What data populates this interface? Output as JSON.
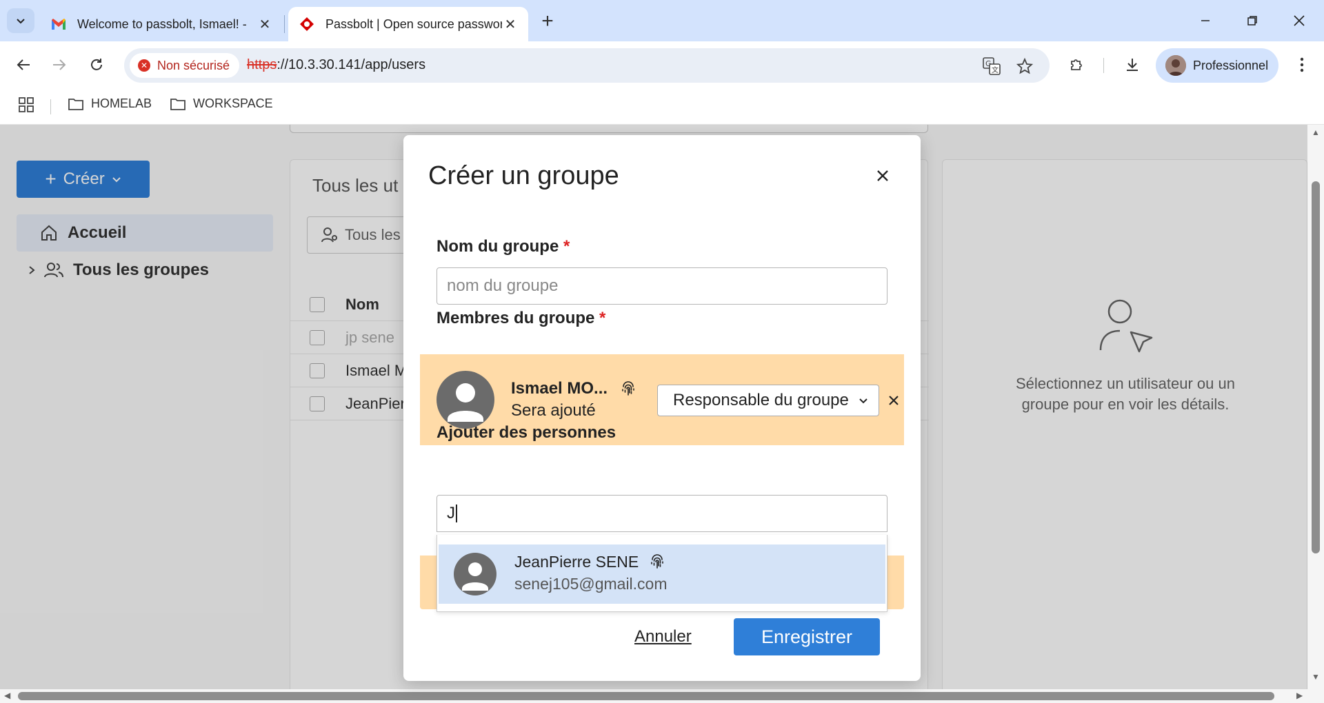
{
  "browser": {
    "tabs": [
      {
        "title": "Welcome to passbolt, Ismael! -",
        "icon": "gmail-icon",
        "active": false
      },
      {
        "title": "Passbolt | Open source passwor",
        "icon": "passbolt-icon",
        "active": true
      }
    ],
    "address": {
      "security_label": "Non sécurisé",
      "protocol": "https",
      "url_rest": "://10.3.30.141/app/users"
    },
    "profile_label": "Professionnel",
    "bookmarks": [
      "HOMELAB",
      "WORKSPACE"
    ]
  },
  "sidebar": {
    "create_label": "Créer",
    "items": [
      {
        "label": "Accueil",
        "icon": "home-icon"
      },
      {
        "label": "Tous les groupes",
        "icon": "users-icon"
      }
    ]
  },
  "main": {
    "title": "Tous les ut",
    "filter_label": "Tous les",
    "column_name": "Nom",
    "rows": [
      "jp sene",
      "Ismael M",
      "JeanPier"
    ]
  },
  "details": {
    "empty_text": "Sélectionnez un utilisateur ou un groupe pour en voir les détails."
  },
  "dialog": {
    "title": "Créer un groupe",
    "name_label": "Nom du groupe",
    "name_placeholder": "nom du groupe",
    "members_label": "Membres du groupe",
    "required_mark": "*",
    "member": {
      "name": "Ismael MO...",
      "status": "Sera ajouté",
      "role": "Responsable du groupe"
    },
    "add_label": "Ajouter des personnes",
    "search_value": "J",
    "suggestion": {
      "name": "JeanPierre SENE",
      "email": "senej105@gmail.com"
    },
    "cancel_label": "Annuler",
    "save_label": "Enregistrer"
  },
  "colors": {
    "primary": "#2f7fd8",
    "member_highlight": "#ffdba8",
    "suggestion_highlight": "#d4e3f7",
    "insecure": "#d93025"
  }
}
